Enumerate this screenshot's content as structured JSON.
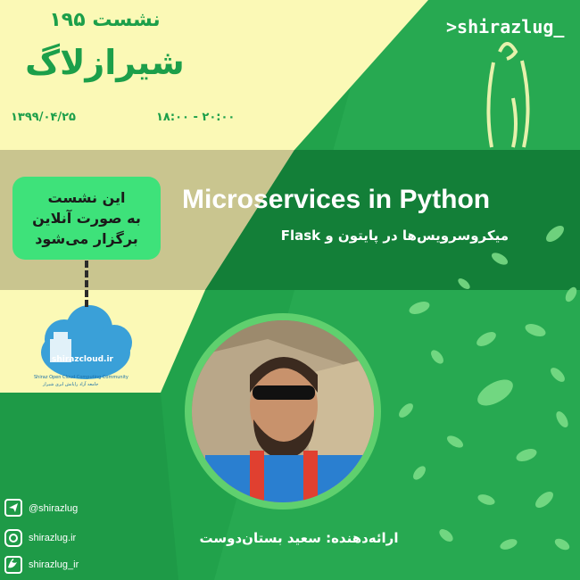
{
  "session": {
    "label": "نشست ۱۹۵"
  },
  "brand": {
    "fa_name": "شیرازلاگ",
    "logo_text": ">shirazlug_"
  },
  "schedule": {
    "date": "۱۳۹۹/۰۴/۲۵",
    "time": "۱۸:۰۰ - ۲۰:۰۰"
  },
  "notice": {
    "line1": "این نشست",
    "line2": "به صورت آنلاین",
    "line3": "برگزار می‌شود"
  },
  "talk": {
    "title": "Microservices in Python",
    "subtitle": "میکروسرویس‌ها در پایتون و Flask"
  },
  "sponsor": {
    "name": "shirazcloud.ir",
    "tagline_en": "Shiraz Open Cloud Computing Community",
    "tagline_fa": "جامعه آزاد رایانش ابری شیراز"
  },
  "presenter": {
    "label": "ارائه‌دهنده: سعید بستان‌دوست"
  },
  "social": {
    "telegram": "@shirazlug",
    "instagram": "shirazlug.ir",
    "twitter": "shirazlug_ir"
  },
  "colors": {
    "yellow": "#fbf9b6",
    "green": "#1f9a48",
    "dark_green": "#137f38",
    "band": "#c8c494",
    "accent": "#3ee27a"
  }
}
